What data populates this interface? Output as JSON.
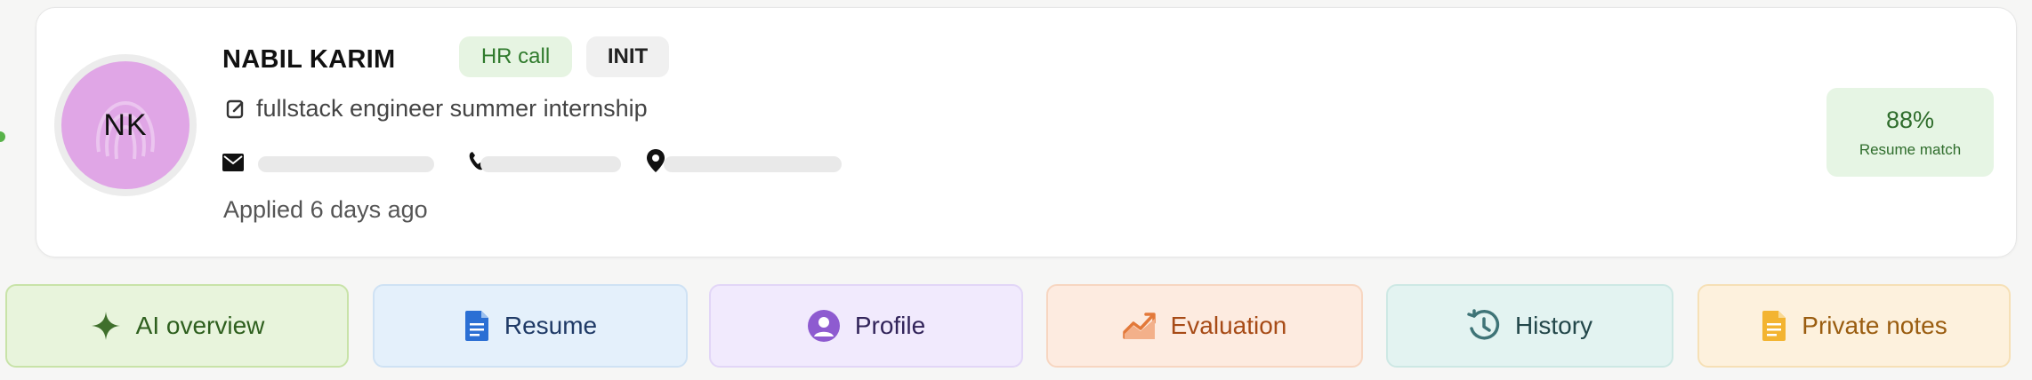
{
  "candidate": {
    "initials": "NK",
    "name": "NABIL KARIM",
    "badges": [
      "HR call",
      "INIT"
    ],
    "job": "fullstack engineer summer internship",
    "applied": "Applied 6 days ago"
  },
  "match": {
    "percent": "88%",
    "label": "Resume match"
  },
  "tabs": [
    {
      "label": "AI overview"
    },
    {
      "label": "Resume"
    },
    {
      "label": "Profile"
    },
    {
      "label": "Evaluation"
    },
    {
      "label": "History"
    },
    {
      "label": "Private notes"
    }
  ],
  "icons": {
    "job": "edit-square-icon",
    "email": "mail-icon",
    "phone": "phone-icon",
    "location": "location-pin-icon"
  },
  "colors": {
    "avatar_bg": "#e0a6e6",
    "hr_badge_bg": "#e6f4e2",
    "match_bg": "#e6f5e4",
    "tab_ai": "#e8f4dc",
    "tab_resume": "#e4f0fb",
    "tab_profile": "#f1eafd",
    "tab_evaluation": "#fdebe0",
    "tab_history": "#e3f3f1",
    "tab_notes": "#fdf1dd"
  }
}
